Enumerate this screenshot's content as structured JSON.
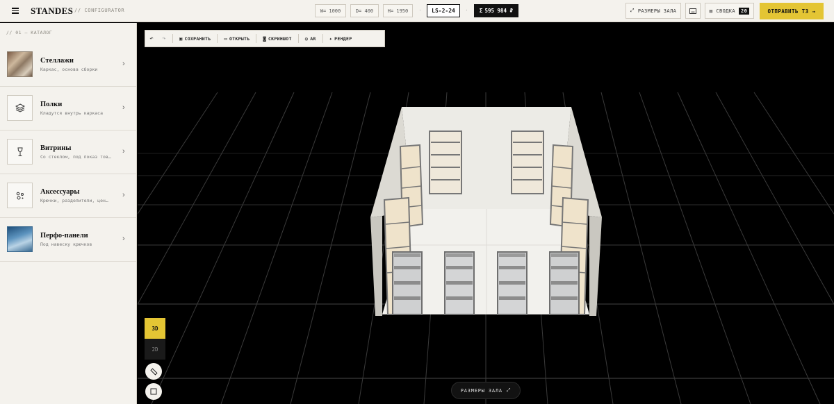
{
  "header": {
    "brand": "STANDES",
    "brand_sub": "// CONFIGURATOR",
    "width": "W= 1000",
    "depth": "D= 400",
    "height": "H= 1950",
    "separator": "·",
    "code": "LS-2-24",
    "price_symbol": "Σ",
    "price": "595 984 ₽",
    "room_size_btn": "РАЗМЕРЫ ЗАЛА",
    "summary_btn": "СВОДКА",
    "summary_count": "20",
    "send_btn": "ОТПРАВИТЬ ТЗ",
    "send_arrow": "→"
  },
  "sidebar": {
    "heading": "// 01 — КАТАЛОГ",
    "chevron": "›",
    "items": [
      {
        "title": "Стеллажи",
        "subtitle": "Каркас, основа сборки",
        "icon": "shelving-photo"
      },
      {
        "title": "Полки",
        "subtitle": "Кладутся внутрь каркаса",
        "icon": "layers-icon"
      },
      {
        "title": "Витрины",
        "subtitle": "Со стеклом, под показ тов…",
        "icon": "wine-glass-icon"
      },
      {
        "title": "Аксессуары",
        "subtitle": "Крючки, разделители, цен…",
        "icon": "accessories-icon"
      },
      {
        "title": "Перфо-панели",
        "subtitle": "Под навеску крючков",
        "icon": "perforated-panel-photo"
      }
    ]
  },
  "toolbar": {
    "undo": "↶",
    "redo": "↷",
    "save": "СОХРАНИТЬ",
    "open": "ОТКРЫТЬ",
    "screenshot": "СКРИНШОТ",
    "ar": "AR",
    "render": "РЕНДЕР"
  },
  "viewport": {
    "mode_3d": "3D",
    "mode_2d": "2D",
    "room_size_pill": "РАЗМЕРЫ ЗАЛА",
    "room_size_icon": "⤢"
  },
  "colors": {
    "accent": "#e4c534",
    "panel": "#f4f2ed",
    "canvas": "#000000"
  }
}
